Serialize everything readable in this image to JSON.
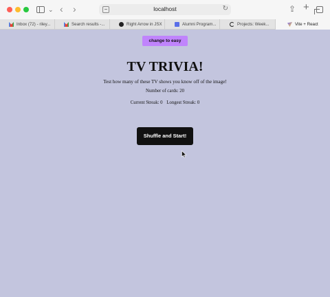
{
  "browser": {
    "url": "localhost",
    "tabs": [
      {
        "label": "Inbox (72) - riley...",
        "icon": "gmail-icon"
      },
      {
        "label": "Search results -...",
        "icon": "gmail-icon"
      },
      {
        "label": "Right Arrow in JSX",
        "icon": "github-icon"
      },
      {
        "label": "Alumni Program...",
        "icon": "doc-icon"
      },
      {
        "label": "Projects: Week...",
        "icon": "codepath-icon"
      },
      {
        "label": "Vite + React",
        "icon": "vite-icon"
      }
    ]
  },
  "page": {
    "mode_button_label": "change to easy",
    "title": "TV TRIVIA!",
    "subtitle": "Test how many of these TV shows you know off of the image!",
    "card_count_text": "Number of cards: 20",
    "current_streak_text": "Current Streak: 0",
    "longest_streak_text": "Longest Streak: 0",
    "start_button_label": "Shuffle and Start!"
  },
  "colors": {
    "page_background": "#c3c5de",
    "mode_button": "#c084fc",
    "start_button": "#111111"
  }
}
